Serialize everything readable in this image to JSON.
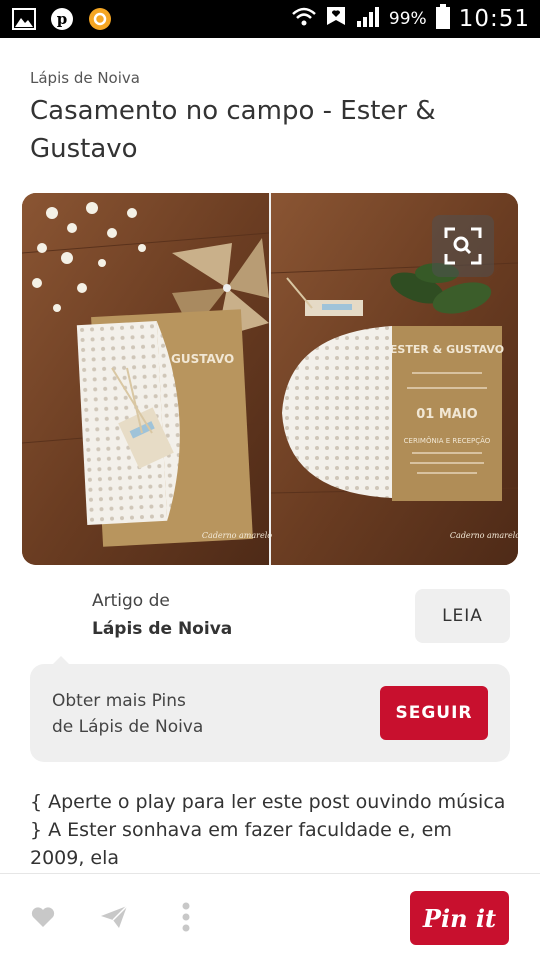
{
  "status_bar": {
    "battery_percent": "99%",
    "time": "10:51",
    "left_icons": [
      "image-icon",
      "pinterest-icon",
      "app-notification-icon"
    ],
    "right_icons": [
      "wifi-icon",
      "notification-icon",
      "signal-icon",
      "battery-icon"
    ]
  },
  "pin": {
    "source_label": "Lápis de Noiva",
    "title": "Casamento no campo - Ester & Gustavo",
    "image": {
      "left_card": {
        "names": "ESTER & GUSTAVO"
      },
      "right_card": {
        "names": "ESTER & GUSTAVO",
        "date_label": "01 MAIO",
        "ceremony": "CERIMÔNIA E RECEPÇÃO"
      },
      "watermark": "Caderno amarelo"
    }
  },
  "article": {
    "caption": "Artigo de",
    "source": "Lápis de Noiva",
    "read_button": "LEIA"
  },
  "follow": {
    "line1": "Obter mais Pins",
    "line2": "de Lápis de Noiva",
    "button": "SEGUIR"
  },
  "description": "{ Aperte o play para ler este post ouvindo música } A Ester sonhava em fazer faculdade e, em 2009, ela",
  "bottom_bar": {
    "icons": [
      "heart-icon",
      "send-icon",
      "more-icon"
    ],
    "pin_button": "Pin it"
  },
  "colors": {
    "accent": "#c8102e",
    "status_bar": "#000000",
    "panel": "#efefef"
  }
}
